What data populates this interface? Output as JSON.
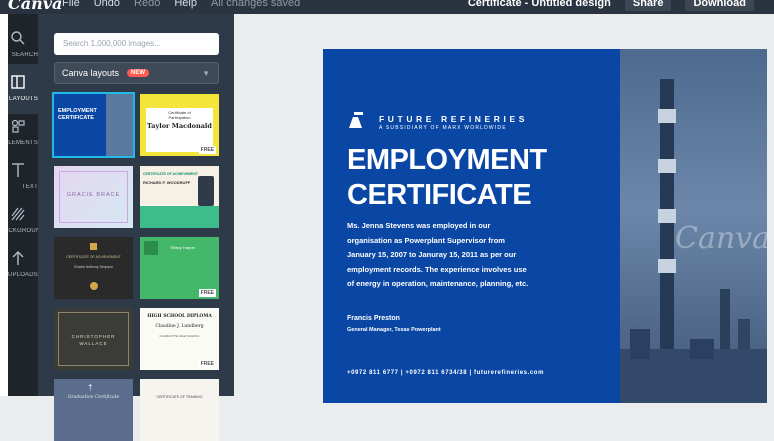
{
  "topbar": {
    "logo": "Canva",
    "menu": [
      "File",
      "Undo",
      "Redo",
      "Help"
    ],
    "status": "All changes saved",
    "design_title": "Certificate - Untitled design",
    "share": "Share",
    "download": "Download"
  },
  "rail": [
    {
      "label": "SEARCH",
      "icon": "search-icon"
    },
    {
      "label": "LAYOUTS",
      "icon": "layouts-icon"
    },
    {
      "label": "ELEMENTS",
      "icon": "elements-icon"
    },
    {
      "label": "TEXT",
      "icon": "text-icon"
    },
    {
      "label": "BACKGROUND",
      "icon": "background-icon"
    },
    {
      "label": "UPLOADS",
      "icon": "uploads-icon"
    }
  ],
  "panel": {
    "search_placeholder": "Search 1,000,000 images...",
    "select_label": "Canva layouts",
    "new_badge": "NEW",
    "free_badge": "FREE",
    "thumbs": {
      "t1_line1": "EMPLOYMENT",
      "t1_line2": "CERTIFICATE",
      "t2_line1": "Certificate of",
      "t2_line2": "Participation",
      "t2_name": "Taylor Macdonald",
      "t3_name": "GRACIE BRACE",
      "t4_line1": "CERTIFICATE OF ACHIEVEMENT",
      "t4_name": "RICHARD F. WOODRUFF",
      "t5_line1": "CERTIFICATE OF ACHIEVEMENT",
      "t5_name": "Charlie Anthony Simpson",
      "t6_name": "Tiffany Harper",
      "t7_line1": "CHRISTOPHER",
      "t7_line2": "WALLACE",
      "t8_line1": "HIGH SCHOOL DIPLOMA",
      "t8_name": "Claudine J. Lundberg",
      "t8_school": "CHARLOTTE HIGH SCHOOL",
      "t9_line": "Graduation Certificate",
      "t10_line": "CERTIFICATE OF TRAINING"
    }
  },
  "certificate": {
    "brand": "FUTURE REFINERIES",
    "brand_sub": "A SUBSIDIARY OF MARX WORLDWIDE",
    "title1": "EMPLOYMENT",
    "title2": "CERTIFICATE",
    "body_lines": [
      "Ms. Jenna Stevens was employed in our",
      "organisation as Powerplant Supervisor from",
      "January 15, 2007 to Januray 15, 2011 as per our",
      "employment records. The experience involves use",
      "of energy in operation, maintenance, planning, etc."
    ],
    "signer": "Francis Preston",
    "signer_role": "General Manager, Texas Powerplant",
    "contact": "+0972 811 6777 | +0972 811 6734/38 | futurerefineries.com",
    "watermark": "Canva"
  },
  "colors": {
    "cert_blue": "#0a47a5",
    "panel_bg": "#2e3a47",
    "rail_bg": "#1f242b",
    "new_badge": "#ff5a4f"
  }
}
